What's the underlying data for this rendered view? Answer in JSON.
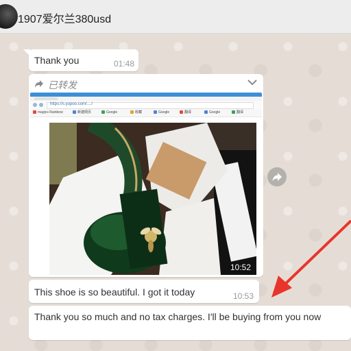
{
  "header": {
    "contact_name": "1907爱尔兰380usd"
  },
  "messages": {
    "thanks": {
      "text": "Thank you",
      "time": "01:48"
    },
    "forwarded_image": {
      "forward_label": "已转发",
      "forward_icon": "forward-arrow-icon",
      "menu_icon": "chevron-down-icon",
      "time": "10:52",
      "browser": {
        "url": "https://s.yupoo.com/..../",
        "bookmarks": [
          "magics Rainbow",
          "新建网页",
          "Google",
          "收藏",
          "Google",
          "翻译",
          "Google",
          "翻译"
        ]
      }
    },
    "beautiful": {
      "text": "This shoe is so beautiful. I got it today",
      "time": "10:53"
    },
    "reply": {
      "text": "Thank you so much and no tax charges. I'll be buying from you now"
    }
  },
  "side_actions": {
    "forward_button_icon": "share-forward-icon"
  },
  "colors": {
    "header_bg": "#ededed",
    "wallpaper": "#e5ddd5",
    "bubble": "#ffffff",
    "annotation_arrow": "#e8352b"
  }
}
